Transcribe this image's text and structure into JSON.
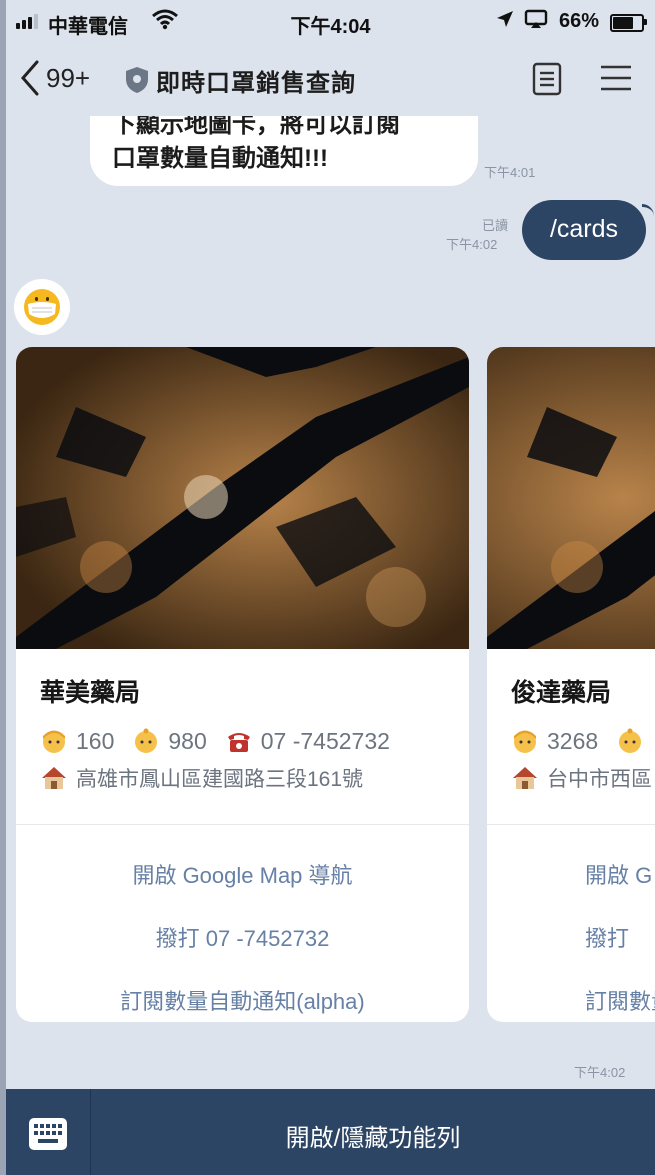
{
  "status_bar": {
    "carrier": "中華電信",
    "time": "下午4:04",
    "battery": "66%",
    "battery_level": 0.66
  },
  "header": {
    "back_count": "99+",
    "title": "即時口罩銷售查詢"
  },
  "messages": {
    "incoming_lines": [
      "下顯示地圖卡，將可以訂閱",
      "口罩數量自動通知!!!"
    ],
    "incoming_time": "下午4:01",
    "outgoing_text": "/cards",
    "read_label": "已讀",
    "outgoing_time": "下午4:02"
  },
  "cards": [
    {
      "name": "華美藥局",
      "adult_count": "160",
      "child_count": "980",
      "phone": "07 -7452732",
      "address": "高雄市鳳山區建國路三段161號",
      "actions": [
        "開啟 Google Map 導航",
        "撥打 07 -7452732",
        "訂閱數量自動通知(alpha)"
      ]
    },
    {
      "name": "俊達藥局",
      "adult_count": "3268",
      "address": "台中市西區",
      "actions": [
        "開啟 G",
        "撥打",
        "訂閱數量"
      ]
    }
  ],
  "carousel_time": "下午4:02",
  "bottom_bar": {
    "menu_toggle": "開啟/隱藏功能列"
  },
  "icons": {
    "adult": "adult-icon",
    "child": "child-icon",
    "phone": "phone-icon",
    "home": "house-icon"
  },
  "colors": {
    "accent": "#2d4565",
    "chat_bg": "#dde3ec",
    "link": "#6680a6"
  }
}
